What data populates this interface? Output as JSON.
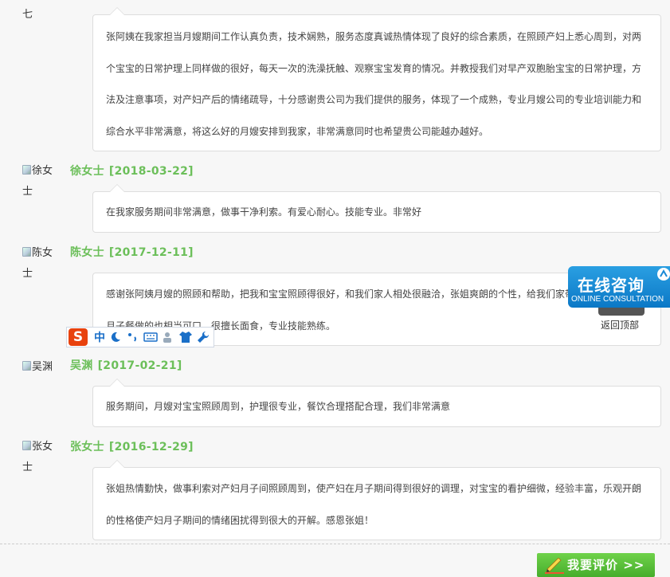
{
  "reviews": [
    {
      "avatar_alt": "七",
      "has_icon": false,
      "name": "",
      "date": "",
      "text": "张阿姨在我家担当月嫂期间工作认真负责，技术娴熟，服务态度真诚热情体现了良好的综合素质，在照顾产妇上悉心周到，对两个宝宝的日常护理上同样做的很好，每天一次的洗澡抚触、观察宝宝发育的情况。并教授我们对早产双胞胎宝宝的日常护理，方法及注意事项，对产妇产后的情绪疏导，十分感谢贵公司为我们提供的服务，体现了一个成熟，专业月嫂公司的专业培训能力和综合水平非常满意，将这么好的月嫂安排到我家，非常满意同时也希望贵公司能越办越好。"
    },
    {
      "avatar_alt": "徐女士",
      "has_icon": true,
      "name": "徐女士",
      "date": "[2018-03-22]",
      "text": "在我家服务期间非常满意，做事干净利索。有爱心耐心。技能专业。非常好"
    },
    {
      "avatar_alt": "陈女士",
      "has_icon": true,
      "name": "陈女士",
      "date": "[2017-12-11]",
      "text": "感谢张阿姨月嫂的照顾和帮助，把我和宝宝照顾得很好，和我们家人相处很融洽，张姐爽朗的个性，给我们家带来了很多欢乐，月子餐做的也相当可口，很擅长面食，专业技能熟练。"
    },
    {
      "avatar_alt": "吴渊",
      "has_icon": true,
      "name": "吴渊",
      "date": "[2017-02-21]",
      "text": "服务期间，月嫂对宝宝照顾周到，护理很专业，餐饮合理搭配合理，我们非常满意"
    },
    {
      "avatar_alt": "张女士",
      "has_icon": true,
      "name": "张女士",
      "date": "[2016-12-29]",
      "text": "张姐热情勤快，做事利索对产妇月子间照顾周到，使产妇在月子期间得到很好的调理，对宝宝的看护细微，经验丰富，乐观开朗的性格使产妇月子期间的情绪困扰得到很大的开解。感恩张姐！"
    }
  ],
  "consult": {
    "title": "在线咨询",
    "subtitle": "ONLINE CONSULTATION",
    "back_top": "返回顶部"
  },
  "ime": {
    "logo": "S",
    "mode": "中"
  },
  "review_button": {
    "label": "我要评价 >>"
  },
  "colors": {
    "accent_green": "#6cbf5a",
    "consult_blue": "#0b78c6",
    "ime_orange": "#e8420e"
  }
}
